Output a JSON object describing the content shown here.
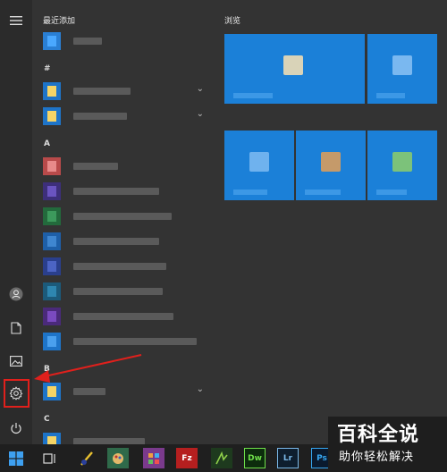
{
  "applist": {
    "recent_title": "最近添加",
    "letters": [
      "#",
      "A",
      "B",
      "C"
    ]
  },
  "tiles": {
    "title": "浏览"
  },
  "taskbar": {
    "items": [
      "Fz",
      "Dw",
      "Lr",
      "Ps"
    ]
  },
  "watermark": {
    "main": "百科全说",
    "sub": "助你轻松解决"
  },
  "icons": {
    "menu": "hamburger-icon",
    "user": "user-icon",
    "documents": "document-icon",
    "pictures": "picture-icon",
    "settings": "gear-icon",
    "power": "power-icon",
    "start": "windows-logo-icon"
  },
  "colors": {
    "tile_blue": "#1b80d8",
    "highlight_red": "#e0201c",
    "background": "#333333"
  }
}
